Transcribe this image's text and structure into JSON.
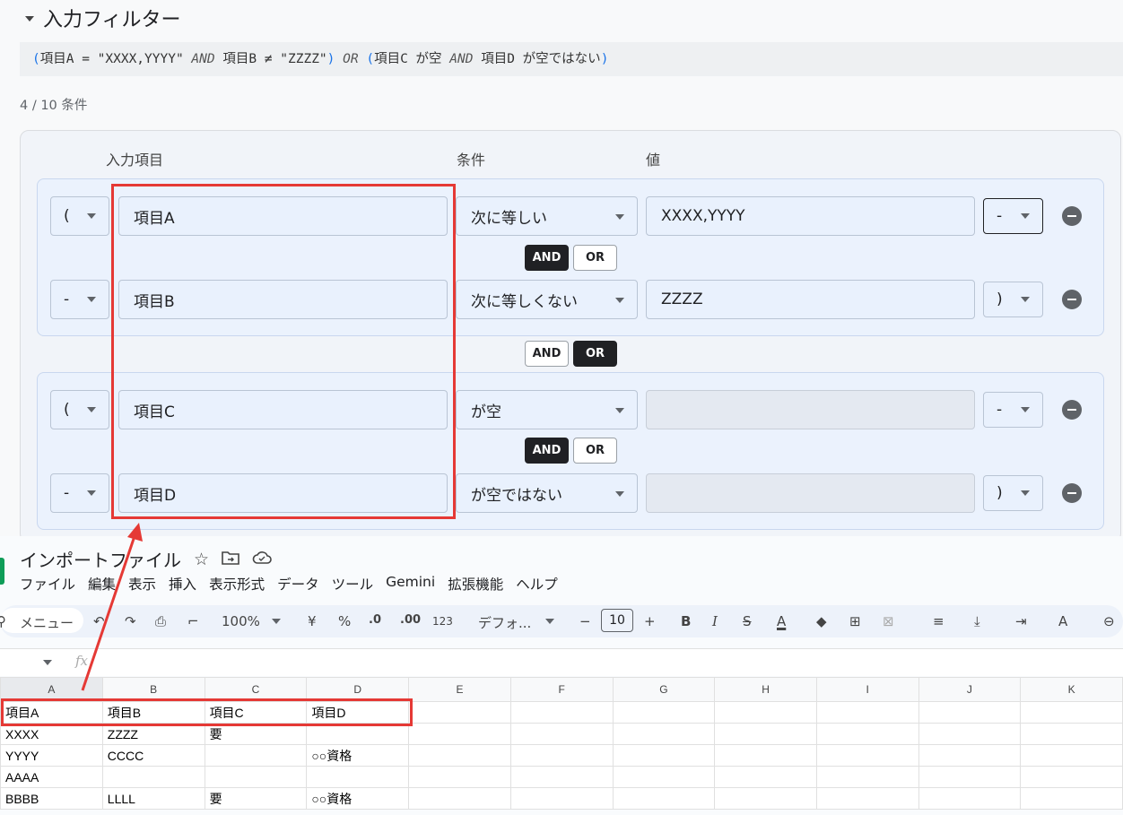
{
  "filter": {
    "title": "入力フィルター",
    "expression": {
      "p1": "(",
      "a": "項目A = \"XXXX,YYYY\"",
      "and1": "AND",
      "b": "項目B ≠ \"ZZZZ\"",
      "p2": ")",
      "or": "OR",
      "p3": "(",
      "c": "項目C が空",
      "and2": "AND",
      "d": "項目D が空ではない",
      "p4": ")"
    },
    "condition_count": "4 / 10 条件",
    "headers": {
      "field": "入力項目",
      "condition": "条件",
      "value": "値"
    },
    "rows": [
      {
        "open": "(",
        "field": "項目A",
        "condition": "次に等しい",
        "value": "XXXX,YYYY",
        "close": "-"
      },
      {
        "open": "-",
        "field": "項目B",
        "condition": "次に等しくない",
        "value": "ZZZZ",
        "close": ")"
      },
      {
        "open": "(",
        "field": "項目C",
        "condition": "が空",
        "value": "",
        "close": "-"
      },
      {
        "open": "-",
        "field": "項目D",
        "condition": "が空ではない",
        "value": "",
        "close": ")"
      }
    ],
    "toggles": {
      "and": "AND",
      "or": "OR"
    }
  },
  "sheet": {
    "doc_title": "インポートファイル",
    "menu": [
      "ファイル",
      "編集",
      "表示",
      "挿入",
      "表示形式",
      "データ",
      "ツール",
      "Gemini",
      "拡張機能",
      "ヘルプ"
    ],
    "toolbar": {
      "menu_search": "メニュー",
      "zoom": "100%",
      "currency": "¥",
      "percent": "%",
      "dec_minus": ".0",
      "dec_plus": ".00",
      "number_format": "123",
      "font": "デフォ...",
      "font_size": "10",
      "bold": "B",
      "italic": "I",
      "fx": "fx"
    },
    "columns": [
      "A",
      "B",
      "C",
      "D",
      "E",
      "F",
      "G",
      "H",
      "I",
      "J",
      "K"
    ],
    "cells": [
      [
        "項目A",
        "項目B",
        "項目C",
        "項目D"
      ],
      [
        "XXXX",
        "ZZZZ",
        "要",
        ""
      ],
      [
        "YYYY",
        "CCCC",
        "",
        "○○資格"
      ],
      [
        "AAAA",
        "",
        "",
        ""
      ],
      [
        "BBBB",
        "LLLL",
        "要",
        "○○資格"
      ]
    ]
  },
  "annotation_color": "#e53935"
}
